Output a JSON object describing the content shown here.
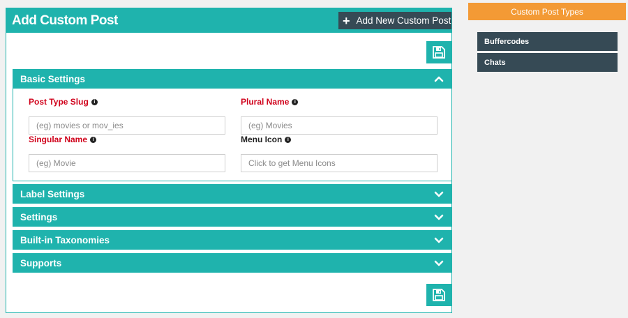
{
  "header": {
    "title": "Add Custom Post",
    "add_new_label": "Add New Custom Post"
  },
  "sections": {
    "basic": "Basic Settings",
    "label": "Label Settings",
    "settings": "Settings",
    "taxonomies": "Built-in Taxonomies",
    "supports": "Supports"
  },
  "fields": {
    "slug": {
      "label": "Post Type Slug",
      "placeholder": "(eg) movies or mov_ies",
      "value": ""
    },
    "plural": {
      "label": "Plural Name",
      "placeholder": "(eg) Movies",
      "value": ""
    },
    "singular": {
      "label": "Singular Name",
      "placeholder": "(eg) Movie",
      "value": ""
    },
    "menu_icon": {
      "label": "Menu Icon",
      "placeholder": "Click to get Menu Icons",
      "value": ""
    }
  },
  "sidebar": {
    "heading": "Custom Post Types",
    "items": [
      {
        "label": "Buffercodes"
      },
      {
        "label": "Chats"
      }
    ]
  },
  "icons": {
    "save": "floppy-disk-icon",
    "info": "info-icon",
    "expand": "chevron-down-icon",
    "collapse": "chevron-up-icon",
    "add": "plus-icon"
  },
  "colors": {
    "primary": "#1fb3ad",
    "dark": "#364a55",
    "sidebar_heading": "#f39a35",
    "required_label": "#d0021b"
  }
}
